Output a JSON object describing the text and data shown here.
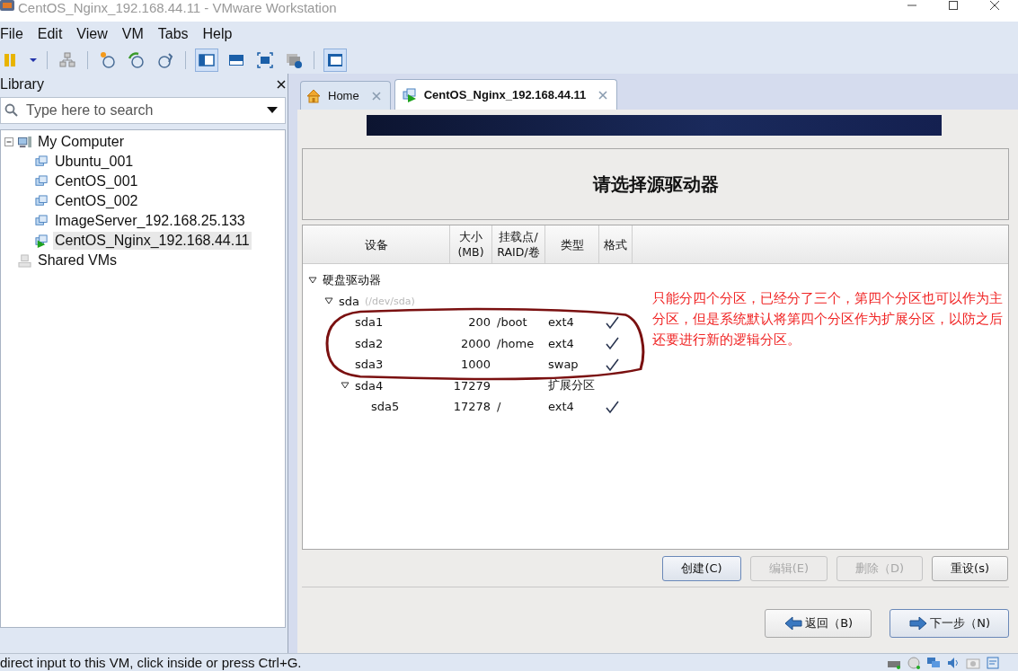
{
  "window": {
    "title": "CentOS_Nginx_192.168.44.11 - VMware Workstation"
  },
  "menu": [
    "File",
    "Edit",
    "View",
    "VM",
    "Tabs",
    "Help"
  ],
  "library": {
    "title": "Library",
    "search": {
      "placeholder": "Type here to search"
    },
    "tree": [
      {
        "label": "My Computer",
        "kind": "computer",
        "expanded": true,
        "children": [
          {
            "label": "Ubuntu_001",
            "kind": "vm",
            "running": false,
            "selected": false
          },
          {
            "label": "CentOS_001",
            "kind": "vm",
            "running": false,
            "selected": false
          },
          {
            "label": "CentOS_002",
            "kind": "vm",
            "running": false,
            "selected": false
          },
          {
            "label": "ImageServer_192.168.25.133",
            "kind": "vm",
            "running": false,
            "selected": false
          },
          {
            "label": "CentOS_Nginx_192.168.44.11",
            "kind": "vm",
            "running": true,
            "selected": true
          }
        ]
      },
      {
        "label": "Shared VMs",
        "kind": "shared"
      }
    ]
  },
  "tabs": [
    {
      "label": "Home",
      "kind": "home",
      "selected": false
    },
    {
      "label": "CentOS_Nginx_192.168.44.11",
      "kind": "vm",
      "selected": true
    }
  ],
  "installer": {
    "heading": "请选择源驱动器",
    "columns": [
      "设备",
      "大小\n(MB)",
      "挂载点/\nRAID/卷",
      "类型",
      "格式"
    ],
    "rows": [
      {
        "device": "硬盘驱动器",
        "expanded": true,
        "children": [
          {
            "device": "sda",
            "detail": "(/dev/sda)",
            "expanded": true,
            "children": [
              {
                "device": "sda1",
                "size": "200",
                "mount": "/boot",
                "type": "ext4",
                "format": true
              },
              {
                "device": "sda2",
                "size": "2000",
                "mount": "/home",
                "type": "ext4",
                "format": true
              },
              {
                "device": "sda3",
                "size": "1000",
                "type": "swap",
                "format": true
              },
              {
                "device": "sda4",
                "size": "17279",
                "type": "扩展分区",
                "format": false,
                "expanded": true,
                "children": [
                  {
                    "device": "sda5",
                    "size": "17278",
                    "mount": "/",
                    "type": "ext4",
                    "format": true
                  }
                ]
              }
            ]
          }
        ]
      }
    ],
    "note": "只能分四个分区，已经分了三个，第四个分区也可以作为主分区，但是系统默认将第四个分区作为扩展分区，以防之后还要进行新的逻辑分区。",
    "actions": [
      {
        "label": "创建(C)",
        "disabled": false,
        "focused": true
      },
      {
        "label": "编辑(E)",
        "disabled": true,
        "focused": false
      },
      {
        "label": "删除（D)",
        "disabled": true,
        "focused": false
      },
      {
        "label": "重设(s)",
        "disabled": false,
        "focused": false
      }
    ],
    "nav": [
      {
        "label": "返回（B)",
        "kind": "back",
        "focused": false
      },
      {
        "label": "下一步（N)",
        "kind": "next",
        "focused": true
      }
    ]
  },
  "status_bar": {
    "text": "direct input to this VM, click inside or press Ctrl+G."
  }
}
